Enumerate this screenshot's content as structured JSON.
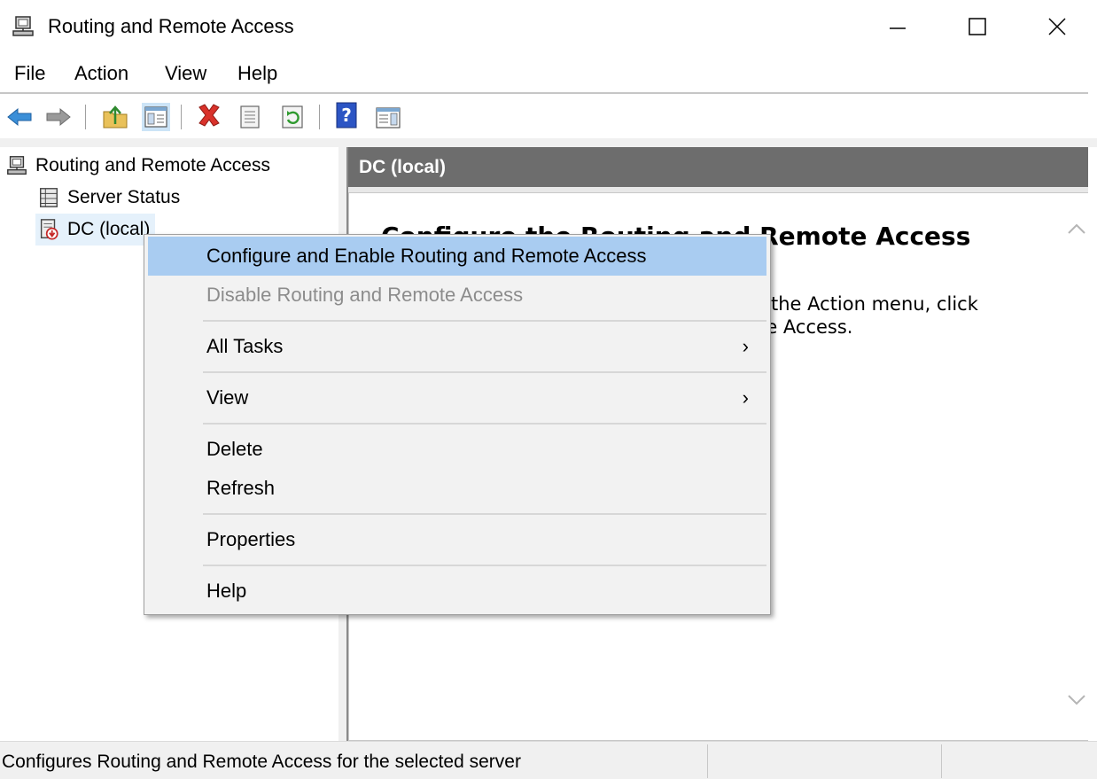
{
  "window": {
    "title": "Routing and Remote Access",
    "minimize_label": "—",
    "maximize_label": "□",
    "close_label": "✕"
  },
  "menubar": {
    "items": [
      {
        "label": "File"
      },
      {
        "label": "Action"
      },
      {
        "label": "View"
      },
      {
        "label": "Help"
      }
    ]
  },
  "toolbar": {
    "buttons": [
      {
        "icon": "back-arrow-icon"
      },
      {
        "icon": "forward-arrow-icon"
      },
      {
        "icon": "up-folder-icon"
      },
      {
        "icon": "show-hide-console-tree-icon"
      },
      {
        "icon": "delete-icon"
      },
      {
        "icon": "properties-icon"
      },
      {
        "icon": "refresh-icon"
      },
      {
        "icon": "help-icon"
      },
      {
        "icon": "show-action-pane-icon"
      }
    ]
  },
  "tree": {
    "root": {
      "label": "Routing and Remote Access",
      "icon": "server-computer-icon"
    },
    "children": [
      {
        "label": "Server Status",
        "icon": "server-status-icon"
      },
      {
        "label": "DC (local)",
        "icon": "server-disabled-icon",
        "selected": true
      }
    ]
  },
  "right_pane": {
    "header": "DC (local)",
    "heading": "Configure the Routing and Remote Access",
    "body_line1": "To set up Routing and Remote Access, on the Action menu, click",
    "body_line2": "Configure and Enable Routing and Remote Access."
  },
  "context_menu": {
    "items": [
      {
        "label": "Configure and Enable Routing and Remote Access",
        "highlighted": true,
        "enabled": true
      },
      {
        "label": "Disable Routing and Remote Access",
        "enabled": false
      },
      {
        "label": "All Tasks",
        "submenu": true
      },
      {
        "label": "View",
        "submenu": true
      },
      {
        "label": "Delete"
      },
      {
        "label": "Refresh"
      },
      {
        "label": "Properties"
      },
      {
        "label": "Help"
      }
    ],
    "submenu_arrow": "›"
  },
  "statusbar": {
    "text": "Configures Routing and Remote Access for the selected server"
  },
  "colors": {
    "menu_highlight": "#a9ccf1",
    "header_bg": "#6d6d6d",
    "disabled_text": "#8c8c8c"
  }
}
